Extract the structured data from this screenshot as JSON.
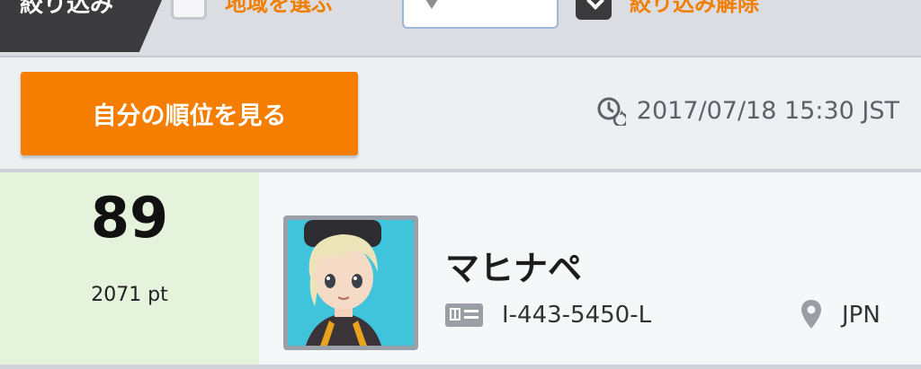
{
  "filter_bar": {
    "tag_label": "絞り込み",
    "region_label": "地域を選ぶ",
    "clear_label": "絞り込み解除",
    "region_select_value": ""
  },
  "action_row": {
    "rank_button_label": "自分の順位を見る",
    "timestamp": "2017/07/18 15:30 JST"
  },
  "entry": {
    "rank": "89",
    "points": "2071 pt",
    "name": "マヒナペ",
    "player_id": "I-443-5450-L",
    "country": "JPN"
  },
  "icons": {
    "timestamp": "clock-refresh-icon",
    "player_id": "id-card-icon",
    "country": "location-pin-icon"
  },
  "colors": {
    "accent_orange": "#f57d00",
    "rank_cell_green": "#e5f2dc",
    "filter_tag_dark": "#3b3b3d"
  }
}
